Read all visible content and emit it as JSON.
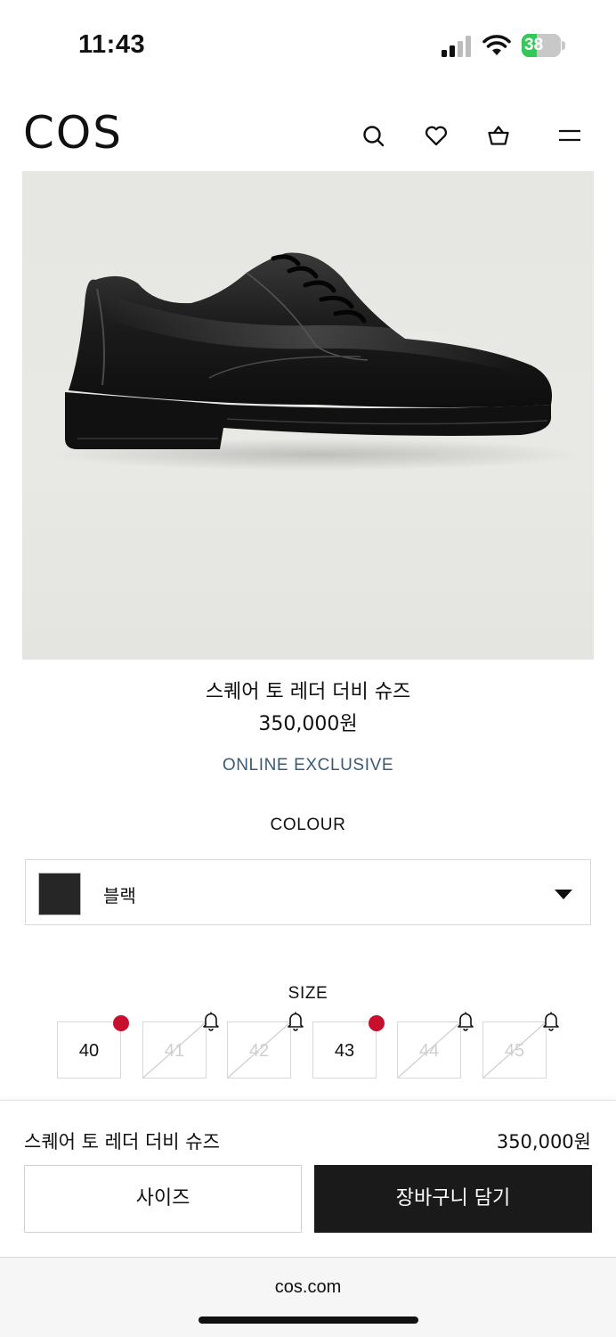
{
  "status_bar": {
    "time": "11:43",
    "battery_level": "38",
    "battery_fraction": 0.38,
    "battery_color": "#34c759"
  },
  "header": {
    "logo": "COS",
    "icons": [
      "search-icon",
      "heart-icon",
      "shopping-bag-icon",
      "menu-icon"
    ]
  },
  "product": {
    "image": "black-leather-derby-shoe",
    "name": "스퀘어 토 레더 더비 슈즈",
    "price": "350,000원",
    "badge": "ONLINE EXCLUSIVE",
    "badge_color": "#3b5b74"
  },
  "colour": {
    "label": "COLOUR",
    "selected": "블랙",
    "swatch_color": "#262626"
  },
  "size": {
    "label": "SIZE",
    "options": [
      {
        "value": "40",
        "available": true,
        "indicator": "low-stock-dot"
      },
      {
        "value": "41",
        "available": false,
        "indicator": "notify-bell-icon"
      },
      {
        "value": "42",
        "available": false,
        "indicator": "notify-bell-icon"
      },
      {
        "value": "43",
        "available": true,
        "indicator": "low-stock-dot"
      },
      {
        "value": "44",
        "available": false,
        "indicator": "notify-bell-icon"
      },
      {
        "value": "45",
        "available": false,
        "indicator": "notify-bell-icon"
      }
    ],
    "dot_color": "#c8102e"
  },
  "sticky_bar": {
    "name": "스퀘어 토 레더 더비 슈즈",
    "price": "350,000원",
    "size_button": "사이즈",
    "cart_button": "장바구니 담기"
  },
  "browser": {
    "url": "cos.com"
  }
}
